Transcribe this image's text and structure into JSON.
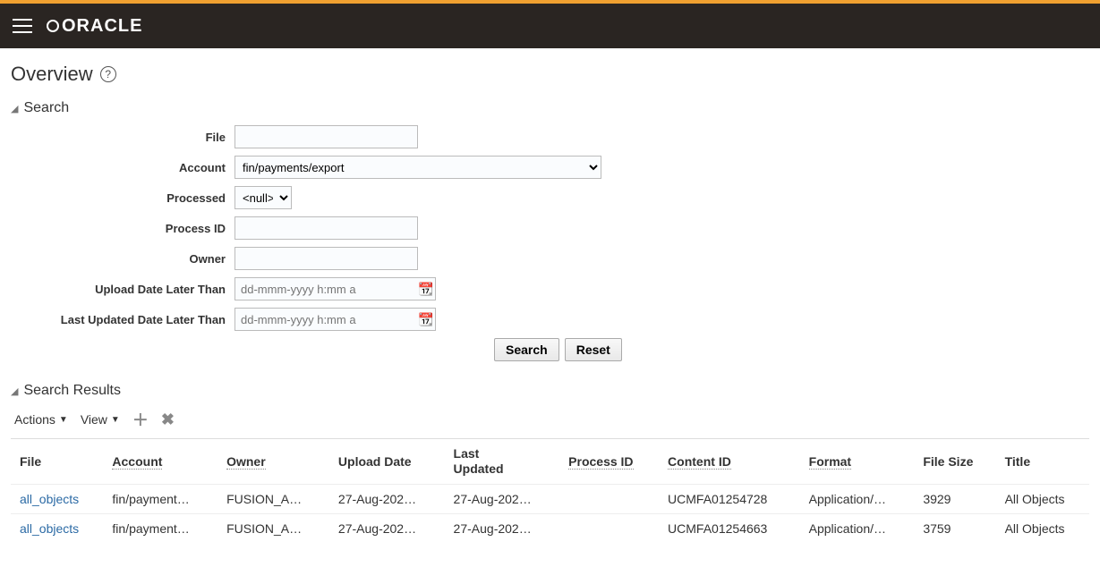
{
  "header": {
    "brand": "ORACLE"
  },
  "page": {
    "title": "Overview"
  },
  "search": {
    "section_title": "Search",
    "labels": {
      "file": "File",
      "account": "Account",
      "processed": "Processed",
      "process_id": "Process ID",
      "owner": "Owner",
      "upload_date_later": "Upload Date Later Than",
      "last_updated_later": "Last Updated Date Later Than"
    },
    "values": {
      "file": "",
      "account": "fin/payments/export",
      "processed": "<null>",
      "process_id": "",
      "owner": "",
      "upload_date_later": "",
      "last_updated_later": ""
    },
    "placeholders": {
      "date": "dd-mmm-yyyy h:mm a"
    },
    "buttons": {
      "search": "Search",
      "reset": "Reset"
    }
  },
  "results": {
    "section_title": "Search Results",
    "toolbar": {
      "actions": "Actions",
      "view": "View"
    },
    "columns": {
      "file": "File",
      "account": "Account",
      "owner": "Owner",
      "upload_date": "Upload Date",
      "last_updated": "Last Updated",
      "process_id": "Process ID",
      "content_id": "Content ID",
      "format": "Format",
      "file_size": "File Size",
      "title": "Title"
    },
    "rows": [
      {
        "file": "all_objects",
        "account": "fin/payment…",
        "owner": "FUSION_A…",
        "upload_date": "27-Aug-202…",
        "last_updated": "27-Aug-202…",
        "process_id": "",
        "content_id": "UCMFA01254728",
        "format": "Application/…",
        "file_size": "3929",
        "title": "All Objects"
      },
      {
        "file": "all_objects",
        "account": "fin/payment…",
        "owner": "FUSION_A…",
        "upload_date": "27-Aug-202…",
        "last_updated": "27-Aug-202…",
        "process_id": "",
        "content_id": "UCMFA01254663",
        "format": "Application/…",
        "file_size": "3759",
        "title": "All Objects"
      }
    ]
  }
}
